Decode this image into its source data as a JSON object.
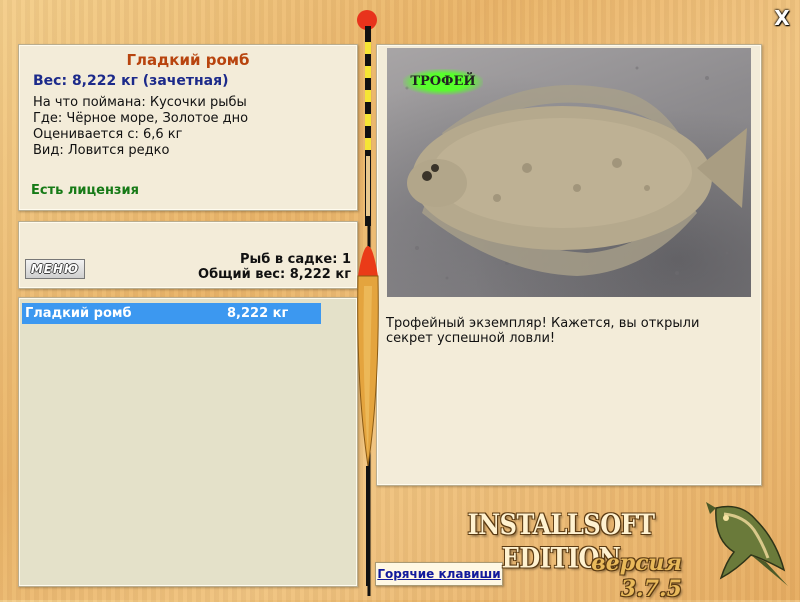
{
  "window": {
    "close_symbol": "X"
  },
  "fish_info": {
    "name": "Гладкий ромб",
    "weight_line": "Вес: 8,222 кг (зачетная)",
    "bait_line": "На что поймана: Кусочки рыбы",
    "location_line": "Где: Чёрное море, Золотое дно",
    "rated_line": "Оценивается с: 6,6 кг",
    "kind_line": "Вид: Ловится редко",
    "license_text": "Есть лицензия"
  },
  "cage": {
    "menu_label": "МЕНЮ",
    "count_line": "Рыб в садке: 1",
    "total_weight_line": "Общий вес: 8,222 кг"
  },
  "catch_list": [
    {
      "name": "Гладкий ромб",
      "weight": "8,222 кг",
      "selected": true
    }
  ],
  "detail": {
    "trophy_badge": "ТРОФЕЙ",
    "description": "Трофейный экземпляр! Кажется, вы открыли секрет успешной ловли!",
    "photo_subject": "flatfish-brill-photo"
  },
  "footer": {
    "hotkeys_label": "Горячие клавиши",
    "brand": "INSTALLSOFT EDITION",
    "version": "версия 3.7.5"
  },
  "colors": {
    "title": "#b8440e",
    "weight": "#1c2a8a",
    "license": "#167a16",
    "selection": "#3c98f0",
    "trophy_glow": "#57ff2b"
  }
}
